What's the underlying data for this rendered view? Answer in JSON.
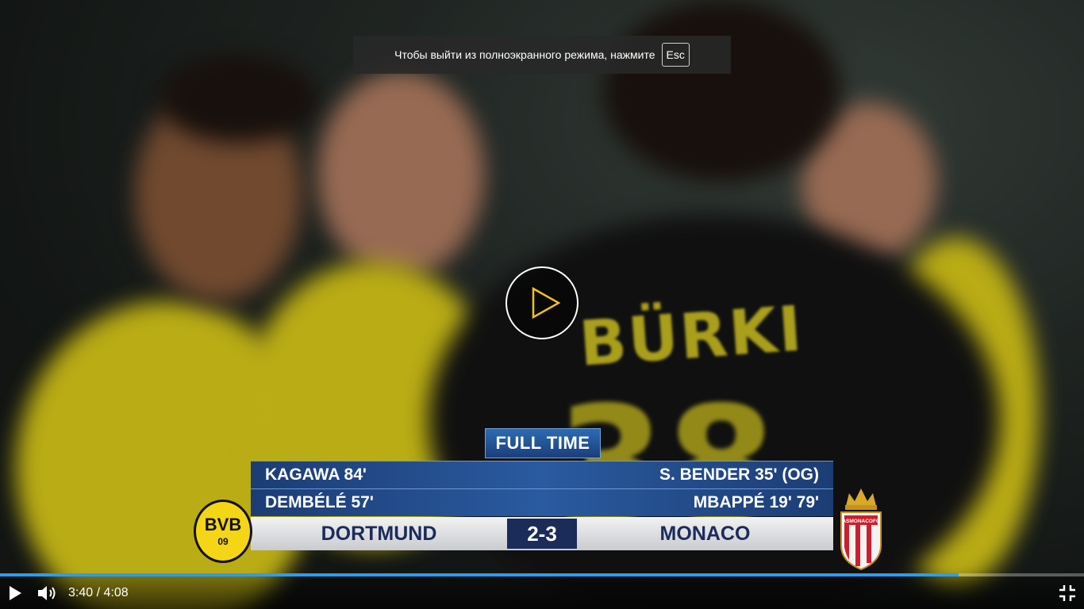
{
  "fullscreen_notice": {
    "text": "Чтобы выйти из полноэкранного режима, нажмите",
    "key": "Esc"
  },
  "scoreboard": {
    "status": "FULL TIME",
    "scorers": [
      {
        "home": "KAGAWA  84'",
        "away": "S. BENDER  35' (OG)"
      },
      {
        "home": "DEMBÉLÉ  57'",
        "away": "MBAPPÉ  19' 79'"
      }
    ],
    "home_team": "DORTMUND",
    "away_team": "MONACO",
    "score": "2-3",
    "home_crest": {
      "top": "BVB",
      "bottom": "09"
    },
    "away_crest": "ASMONACOFC"
  },
  "jersey": {
    "name": "BÜRKI",
    "number": "38"
  },
  "player": {
    "current_time": "3:40",
    "duration": "4:08",
    "time_display": "3:40 / 4:08",
    "progress": 0.884,
    "state": "paused",
    "icons": {
      "center": "play-icon",
      "play": "play-icon",
      "volume": "volume-icon",
      "fullscreen_exit": "exit-fullscreen-icon"
    },
    "colors": {
      "progress": "#2d9cf0",
      "play_accent": "#f2c21a"
    }
  }
}
